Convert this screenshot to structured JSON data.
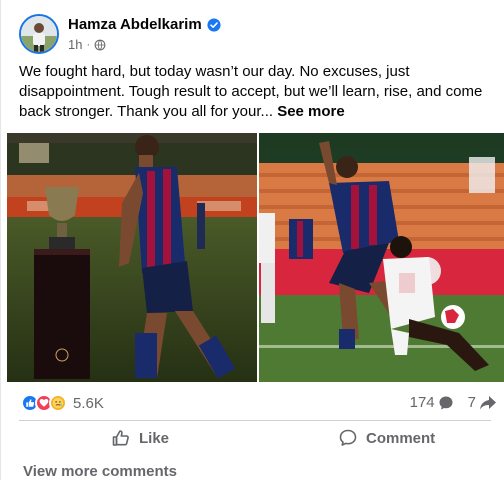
{
  "post": {
    "author": "Hamza Abdelkarim",
    "time": "1h",
    "separator": "·",
    "text": "We fought hard, but today wasn’t our day. No excuses, just disappointment. Tough result to accept, but we’ll learn, rise, and come back stronger. Thank you all for your...",
    "see_more": "See more"
  },
  "stats": {
    "reaction_count": "5.6K",
    "comment_count": "174",
    "share_count": "7",
    "reaction_icons": [
      "like-icon",
      "love-icon",
      "care-icon"
    ]
  },
  "actions": {
    "like_label": "Like",
    "comment_label": "Comment"
  },
  "comments": {
    "view_more": "View more comments"
  },
  "colors": {
    "accent": "#1877f2",
    "secondary_text": "#65676b",
    "barca_blue": "#1a2b6b",
    "barca_red": "#a2123a"
  }
}
